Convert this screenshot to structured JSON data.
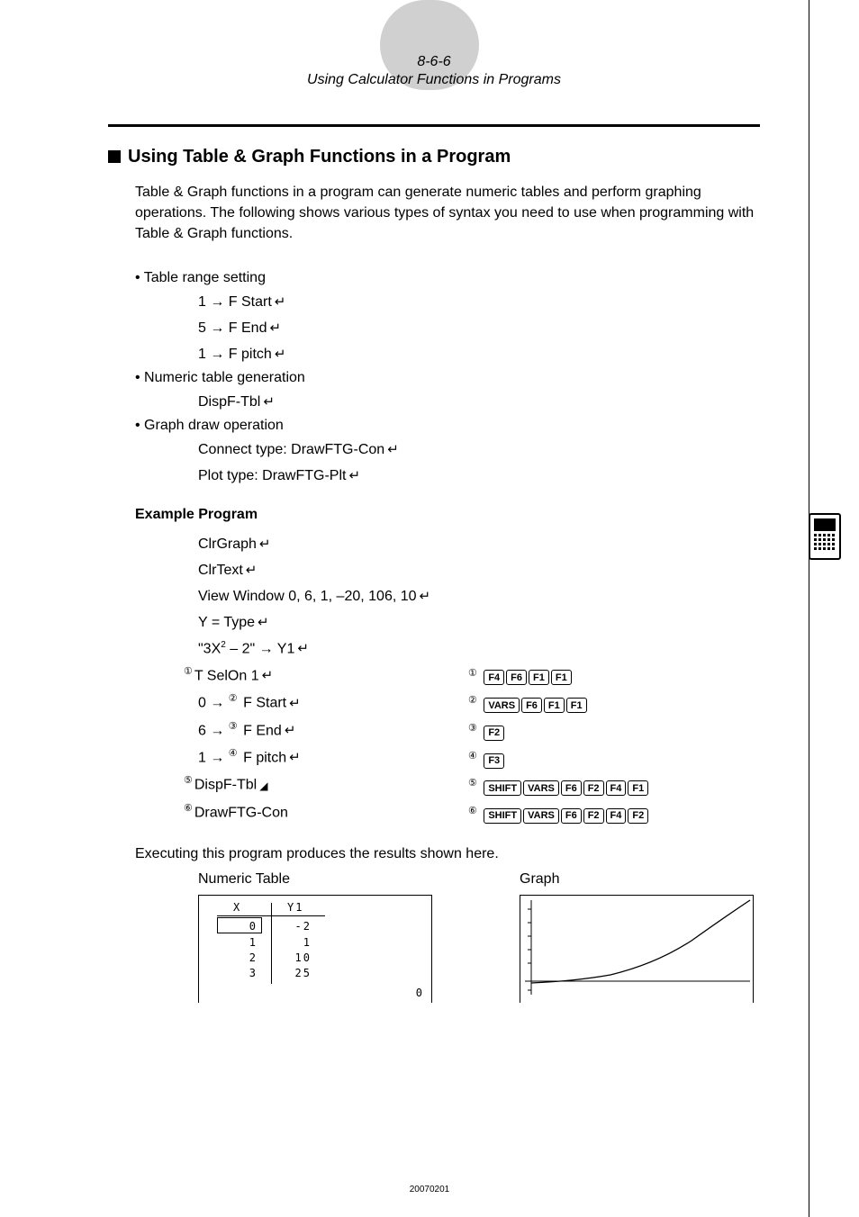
{
  "header": {
    "page_num": "8-6-6",
    "title": "Using Calculator Functions in Programs"
  },
  "section_title": "Using Table & Graph Functions in a Program",
  "intro": "Table & Graph functions in a program can generate numeric tables and perform graphing operations. The following shows various types of syntax you need to use when programming with Table & Graph functions.",
  "bullets": {
    "b1": "• Table range setting",
    "b1_l1": "1 → F  Start",
    "b1_l2": "5 → F  End",
    "b1_l3": "1 → F  pitch",
    "b2": "• Numeric table generation",
    "b2_l1": "DispF-Tbl",
    "b3": "• Graph draw operation",
    "b3_l1": "Connect type: DrawFTG-Con",
    "b3_l2": "Plot type: DrawFTG-Plt"
  },
  "example_h": "Example Program",
  "example_lines": {
    "l1": "ClrGraph",
    "l2": "ClrText",
    "l3": "View Window 0, 6, 1, –20, 106, 10",
    "l4": "Y = Type",
    "l5_a": "\"3X",
    "l5_b": " – 2\" → Y1",
    "l6": "T SelOn 1",
    "l7_a": "0 → ",
    "l7_b": " F  Start",
    "l8_a": "6 → ",
    "l8_b": " F  End",
    "l9_a": "1 → ",
    "l9_b": " F  pitch",
    "l10": "DispF-Tbl",
    "l11": "DrawFTG-Con"
  },
  "circ": {
    "c1": "①",
    "c2": "②",
    "c3": "③",
    "c4": "④",
    "c5": "⑤",
    "c6": "⑥"
  },
  "keys": {
    "F1": "F1",
    "F2": "F2",
    "F3": "F3",
    "F4": "F4",
    "F6": "F6",
    "VARS": "VARS",
    "SHIFT": "SHIFT"
  },
  "exec_text": "Executing this program produces the results shown here.",
  "results": {
    "left_label": "Numeric Table",
    "right_label": "Graph",
    "tbl_hdr_x": "X",
    "tbl_hdr_y": "Y1",
    "r1x": "0",
    "r1y": "-2",
    "r2x": "1",
    "r2y": "1",
    "r3x": "2",
    "r3y": "10",
    "r4x": "3",
    "r4y": "25",
    "corner": "0"
  },
  "chart_data": {
    "type": "line",
    "title": "",
    "xlabel": "",
    "ylabel": "",
    "xlim": [
      0,
      6
    ],
    "ylim": [
      -20,
      106
    ],
    "x": [
      0,
      1,
      2,
      3,
      4,
      5,
      6
    ],
    "y": [
      -2,
      1,
      10,
      25,
      46,
      73,
      106
    ]
  },
  "footer": "20070201"
}
